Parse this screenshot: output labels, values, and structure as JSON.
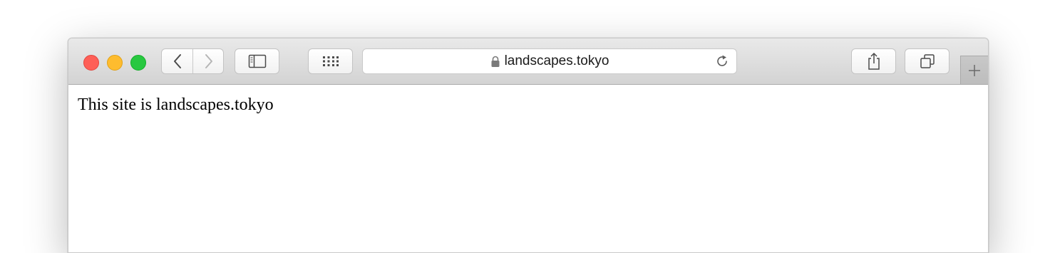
{
  "browser": {
    "address_bar": {
      "url": "landscapes.tokyo",
      "secure": true
    },
    "toolbar": {
      "icons": [
        "back-icon",
        "forward-icon",
        "sidebar-icon",
        "top-sites-icon",
        "lock-icon",
        "reload-icon",
        "share-icon",
        "tabs-overview-icon",
        "plus-icon"
      ]
    }
  },
  "page": {
    "text": "This site is landscapes.tokyo"
  },
  "colors": {
    "close": "#fe5f57",
    "minimize": "#febc2e",
    "zoom": "#28c840",
    "toolbar": "#dcdcdc"
  }
}
